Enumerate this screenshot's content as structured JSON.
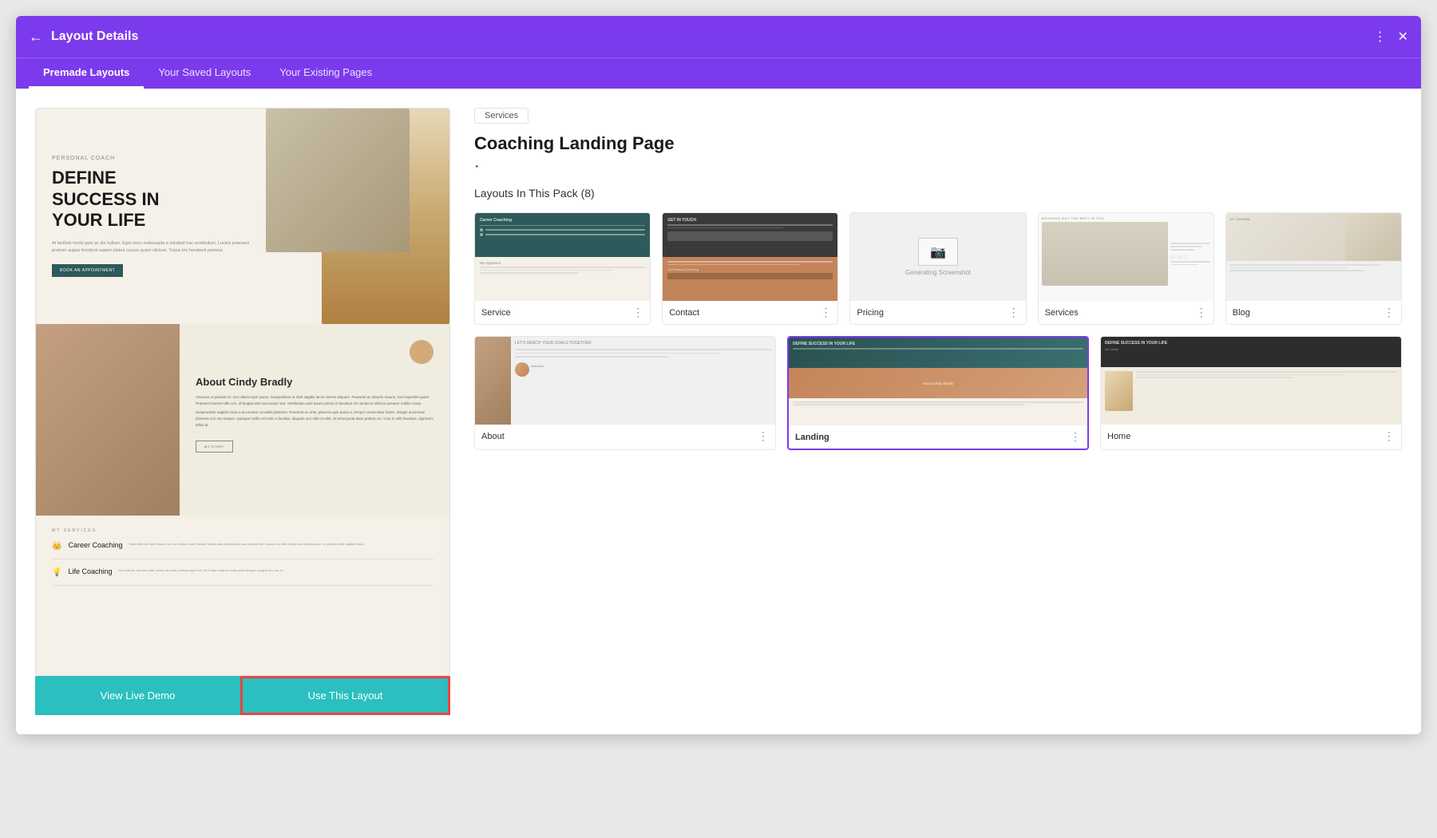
{
  "window": {
    "title": "Layout Details",
    "back_icon": "←",
    "settings_icon": "⚙",
    "close_icon": "✕"
  },
  "tabs": [
    {
      "label": "Premade Layouts",
      "active": true
    },
    {
      "label": "Your Saved Layouts",
      "active": false
    },
    {
      "label": "Your Existing Pages",
      "active": false
    }
  ],
  "preview": {
    "hero_tag": "PERSONAL COACH",
    "hero_title": "DEFINE\nSUCCESS IN\nYOUR LIFE",
    "hero_text": "At facilisis morbi quis ac dis nullam. Eget nunc malesuada a volutpat hac vestibulum. Luctus praesent pretium augue tincidunt sapien platea cursus quam ultrices. Turpis leo hendrerit parietur.",
    "hero_btn": "BOOK AN APPOINTMENT",
    "about_title": "About Cindy Bradly",
    "about_text1": "Vivamus ut gravida mi, nec ullamcorper purus. Suspendisse ut nibh sagittis lacus viverra aliquam. Praesent ac lobortis mauris, non imperdiet quam. Praesent laoreet nibh orci, id feugiat ante accumsan sed. Vestibulum ante ipsum primis in faucibus orci luctus et ultrices posuere cubilia curae.",
    "about_text2": "Suspendisse sagittis lacus a accumsan convallis pharetra. Praesent ex ante, placerat quis purus a, tempor consectetur lorem. Integer accumsan pharetra orci nec tempor. Quisque mollis vel enim a facilisis, aliquam orci nibh ut nibh, sit amet porta diam pretium ex. Cras in velit faucibus, dignissim tellus at.",
    "about_btn": "MY STORY",
    "services_tag": "MY SERVICES",
    "services": [
      {
        "icon": "🛍",
        "name": "Career Coaching",
        "desc": "Imperdiet nisl eget mauris nec non dictum amet facilisi. Malesuada ullamcorper quis mauris nibh massa vel nibh nullam sed tullamcorper. In gravida ante sagittis fusce."
      },
      {
        "icon": "💡",
        "name": "Life Coaching",
        "desc": "Non mauris, ultrices vitae ornare sit amet, ultrices eget orci. Sed vitae nulla et mollis pellentesque congue nec nec et."
      }
    ],
    "btn_demo": "View Live Demo",
    "btn_use": "Use This Layout"
  },
  "right_panel": {
    "tag": "Services",
    "title": "Coaching Landing Page",
    "dot": "·",
    "pack_label": "Layouts In This Pack (8)",
    "thumbnails_row1": [
      {
        "label": "Service",
        "bold": false,
        "type": "service"
      },
      {
        "label": "Contact",
        "bold": false,
        "type": "contact"
      },
      {
        "label": "Pricing",
        "bold": false,
        "type": "pricing"
      },
      {
        "label": "Services",
        "bold": false,
        "type": "services2"
      },
      {
        "label": "Blog",
        "bold": false,
        "type": "blog"
      }
    ],
    "thumbnails_row2": [
      {
        "label": "About",
        "bold": false,
        "type": "about"
      },
      {
        "label": "Landing",
        "bold": true,
        "type": "landing"
      },
      {
        "label": "Home",
        "bold": false,
        "type": "home"
      }
    ]
  }
}
